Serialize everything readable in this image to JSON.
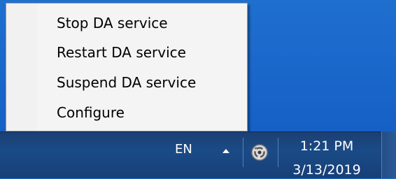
{
  "context_menu": {
    "items": [
      {
        "label": "Stop DA service"
      },
      {
        "label": "Restart DA service"
      },
      {
        "label": "Suspend DA service"
      },
      {
        "label": "Configure"
      }
    ]
  },
  "taskbar": {
    "language": "EN",
    "tray_icon": "da-service-icon",
    "clock": {
      "time": "1:21 PM",
      "date": "3/13/2019"
    }
  },
  "colors": {
    "desktop": "#1766c9",
    "taskbar": "#1a4b86",
    "menu_bg": "#f4f4f4"
  }
}
